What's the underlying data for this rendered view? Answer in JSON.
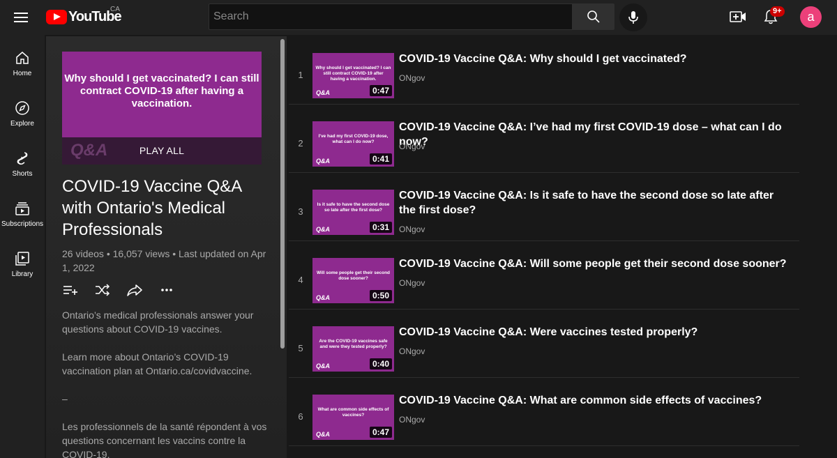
{
  "header": {
    "logo_text": "YouTube",
    "country": "CA",
    "search_placeholder": "Search",
    "notification_count": "9+",
    "avatar_letter": "a"
  },
  "guide": {
    "items": [
      {
        "label": "Home",
        "icon": "home-icon"
      },
      {
        "label": "Explore",
        "icon": "compass-icon"
      },
      {
        "label": "Shorts",
        "icon": "shorts-icon"
      },
      {
        "label": "Subscriptions",
        "icon": "subscriptions-icon"
      },
      {
        "label": "Library",
        "icon": "library-icon"
      }
    ]
  },
  "playlist": {
    "thumb_text": "Why should I get vaccinated? I can still contract COVID-19 after having a vaccination.",
    "thumb_brand": "Q&A",
    "play_all": "PLAY ALL",
    "title": "COVID-19 Vaccine Q&A with Ontario's Medical Professionals",
    "stats": "26 videos • 16,057 views • Last updated on Apr 1, 2022",
    "description": "Ontario’s medical professionals answer your questions about COVID-19 vaccines.\n\nLearn more about Ontario’s COVID-19 vaccination plan at Ontario.ca/covidvaccine.\n\n–\n\nLes professionnels de la santé répondent à vos questions concernant les vaccins contre la COVID-19."
  },
  "videos": [
    {
      "index": "1",
      "title": "COVID-19 Vaccine Q&A: Why should I get vaccinated?",
      "channel": "ONgov",
      "duration": "0:47",
      "thumb_text": "Why should I get vaccinated? I can still contract COVID-19 after having a vaccination."
    },
    {
      "index": "2",
      "title": "COVID-19 Vaccine Q&A: I’ve had my first COVID-19 dose – what can I do now?",
      "channel": "ONgov",
      "duration": "0:41",
      "thumb_text": "I've had my first COVID-19 dose, what can I do now?"
    },
    {
      "index": "3",
      "title": "COVID-19 Vaccine Q&A: Is it safe to have the second dose so late after the first dose?",
      "channel": "ONgov",
      "duration": "0:31",
      "thumb_text": "Is it safe to have the second dose so late after the first dose?"
    },
    {
      "index": "4",
      "title": "COVID-19 Vaccine Q&A: Will some people get their second dose sooner?",
      "channel": "ONgov",
      "duration": "0:50",
      "thumb_text": "Will some people get their second dose sooner?"
    },
    {
      "index": "5",
      "title": "COVID-19 Vaccine Q&A: Were vaccines tested properly?",
      "channel": "ONgov",
      "duration": "0:40",
      "thumb_text": "Are the COVID-19 vaccines safe and were they tested properly?"
    },
    {
      "index": "6",
      "title": "COVID-19 Vaccine Q&A: What are common side effects of vaccines?",
      "channel": "ONgov",
      "duration": "0:47",
      "thumb_text": "What are common side effects of vaccines?"
    }
  ],
  "colors": {
    "background": "#181818",
    "panel": "#212121",
    "thumbnail": "#8e2a8f",
    "brand_red": "#ff0000",
    "avatar": "#ec407a"
  }
}
